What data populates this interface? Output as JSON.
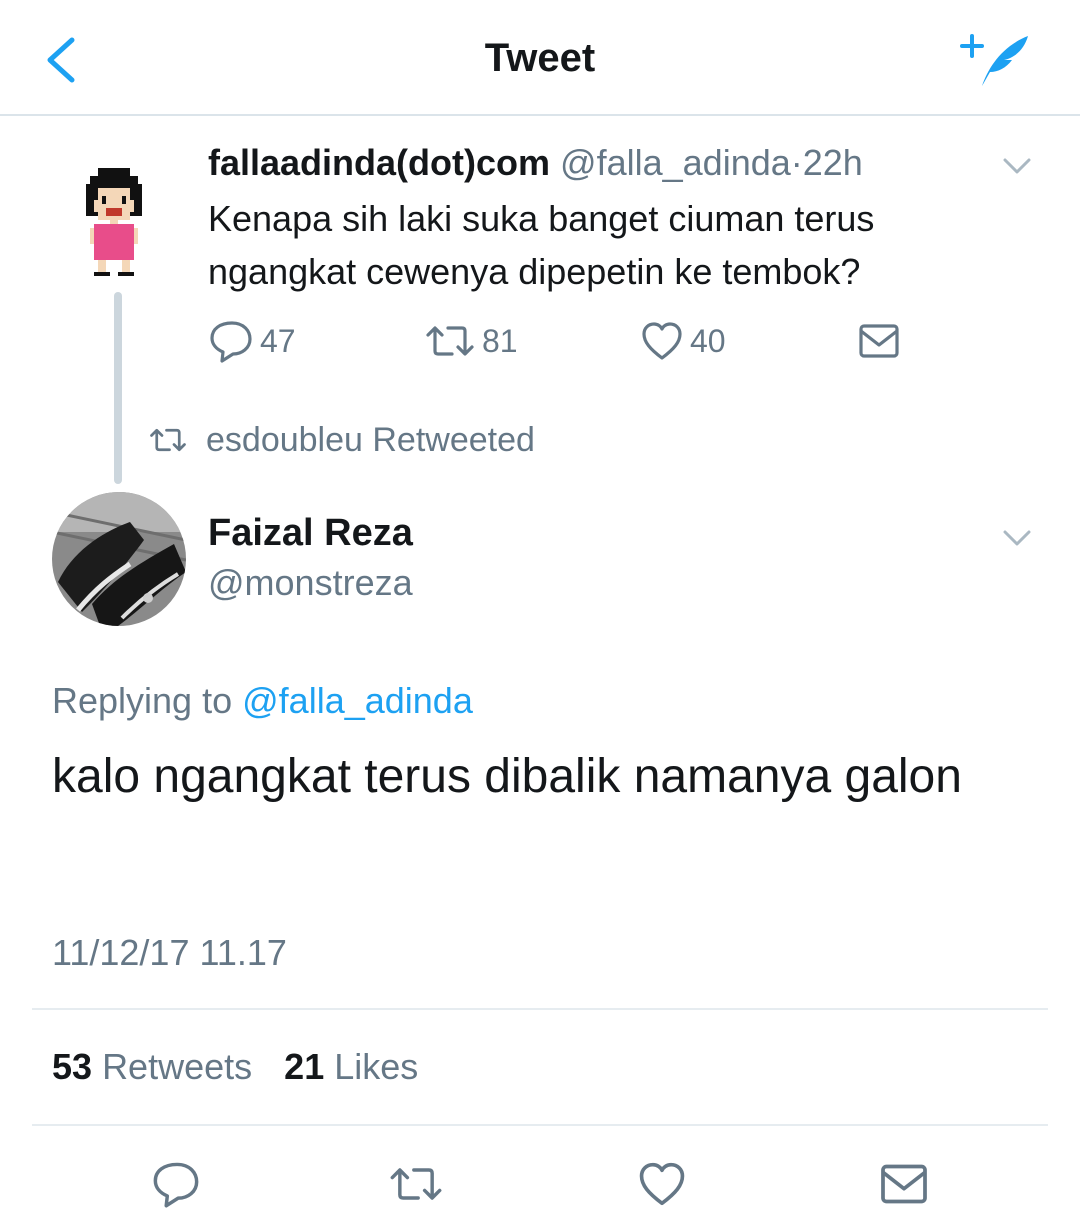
{
  "header": {
    "title": "Tweet",
    "back_icon": "chevron-left-icon",
    "compose_icon": "compose-tweet-icon",
    "accent_color": "#1da1f2"
  },
  "parent_tweet": {
    "display_name": "fallaadinda(dot)com",
    "handle": "@falla_adinda",
    "separator": "·",
    "time": "22h",
    "text": "Kenapa sih laki suka banget ciuman terus ngangkat cewenya dipepetin ke tembok?",
    "actions": {
      "replies": "47",
      "retweets": "81",
      "likes": "40"
    }
  },
  "retweet_context": {
    "text": "esdoubleu Retweeted"
  },
  "main_tweet": {
    "display_name": "Faizal Reza",
    "handle": "@monstreza",
    "replying_label": "Replying to",
    "replying_handle": "@falla_adinda",
    "text": "kalo ngangkat terus dibalik namanya galon",
    "timestamp": "11/12/17 11.17",
    "retweet_count": "53",
    "retweet_label": "Retweets",
    "like_count": "21",
    "like_label": "Likes"
  },
  "colors": {
    "text_primary": "#14171a",
    "text_secondary": "#657786",
    "link": "#1da1f2",
    "divider": "#e6ecf0"
  }
}
